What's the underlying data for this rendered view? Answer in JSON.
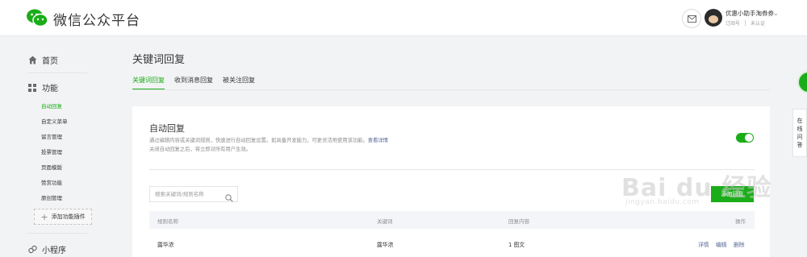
{
  "header": {
    "brand": "微信公众平台",
    "account_name": "优惠小助手淘券券",
    "account_type": "订阅号",
    "account_status": "未认证",
    "icons": {
      "logo": "wechat-logo-icon",
      "mail": "mail-icon",
      "caret": "chevron-down-icon"
    }
  },
  "sidebar": {
    "home": "首页",
    "features": "功能",
    "features_items": [
      {
        "label": "自动回复",
        "active": true
      },
      {
        "label": "自定义菜单",
        "active": false
      },
      {
        "label": "留言管理",
        "active": false
      },
      {
        "label": "投票管理",
        "active": false
      },
      {
        "label": "页面模版",
        "active": false
      },
      {
        "label": "赞赏功能",
        "active": false
      },
      {
        "label": "原创管理",
        "active": false
      }
    ],
    "add_plugin": "添加功能插件",
    "miniprogram": "小程序"
  },
  "main": {
    "title": "关键词回复",
    "tabs": [
      {
        "label": "关键词回复",
        "active": true
      },
      {
        "label": "收到消息回复",
        "active": false
      },
      {
        "label": "被关注回复",
        "active": false
      }
    ],
    "auto_reply": {
      "title": "自动回复",
      "description": "通过编辑内容或关键词规则，快速进行自动回复设置。如具备开发能力，可更灵活地使用该功能。",
      "details_link": "查看详情",
      "note": "关闭自动回复之后，将立即对所有用户生效。",
      "enabled": true
    },
    "search_placeholder": "搜索关键词/规则名称",
    "add_button": "添加回复",
    "table": {
      "headers": [
        "规则名称",
        "关键词",
        "回复内容",
        "操作"
      ],
      "rows": [
        {
          "rule": "露华浓",
          "keyword": "露华浓",
          "reply": "1 图文",
          "actions": [
            "详情",
            "编辑",
            "删除"
          ]
        }
      ]
    }
  },
  "side_widget": {
    "online_help": [
      "在",
      "线",
      "问",
      "答"
    ]
  },
  "watermark": {
    "big": "Bai du 经验",
    "small": "jingyan.baidu.com"
  },
  "colors": {
    "accent": "#1aad19",
    "link": "#576b95",
    "muted": "#8d8d8d"
  }
}
